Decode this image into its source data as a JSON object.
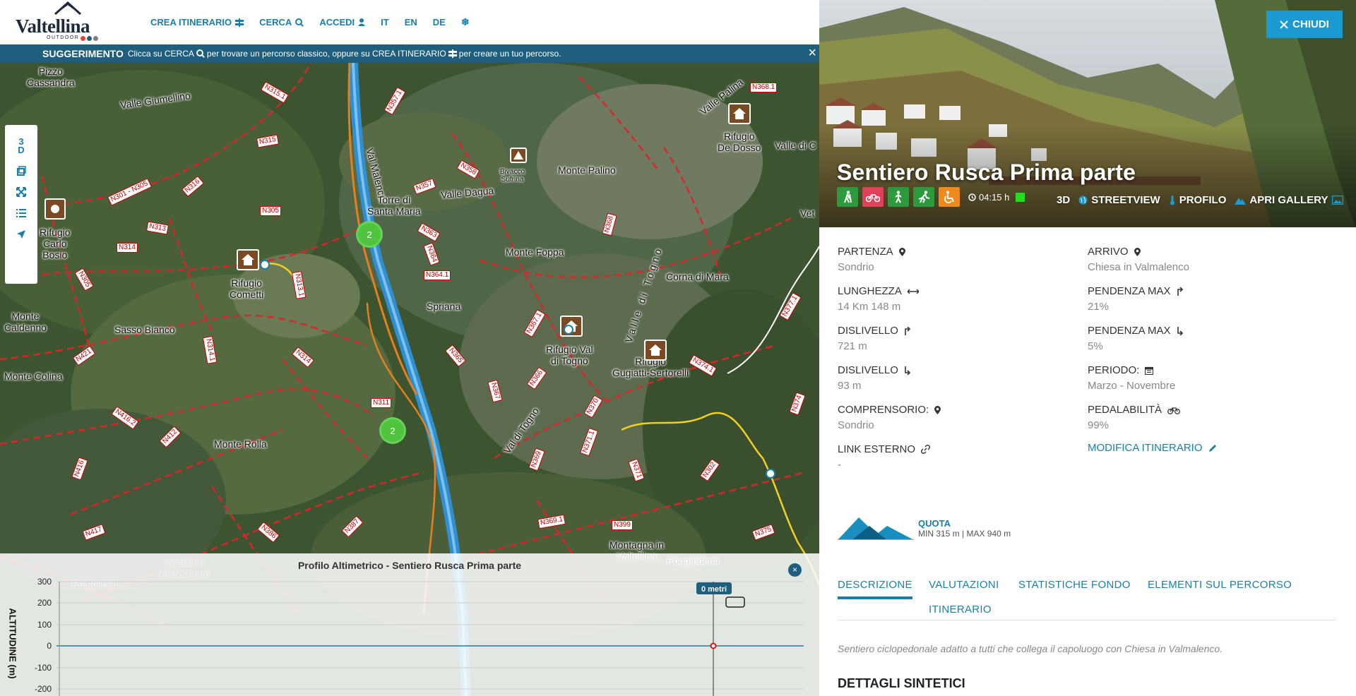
{
  "logo": {
    "brand": "Valtellina",
    "sub": "OUTDOOR",
    "dots": [
      "#e8403a",
      "#1f5f7d",
      "#7f7f7f"
    ]
  },
  "nav": {
    "crea": "CREA ITINERARIO",
    "cerca": "CERCA",
    "accedi": "ACCEDI",
    "lang_it": "IT",
    "lang_en": "EN",
    "lang_de": "DE"
  },
  "hint": {
    "title": "SUGGERIMENTO",
    "part1": "Clicca su CERCA",
    "part2": "per trovare un percorso classico, oppure su CREA ITINERARIO",
    "part3": "per creare un tuo percorso."
  },
  "map": {
    "controls": {
      "three_d": "3 D"
    },
    "labels": [
      {
        "id": "pizzo",
        "text": "Pizzo\nCassandra"
      },
      {
        "id": "giumellino",
        "text": "Valle Giumellino"
      },
      {
        "id": "malenco",
        "text": "Val Malenco"
      },
      {
        "id": "torre",
        "text": "Torre di\nSanta Maria"
      },
      {
        "id": "dagua",
        "text": "Valle Dagua"
      },
      {
        "id": "bivacco",
        "text": "Bivacco\nSufrina"
      },
      {
        "id": "palino",
        "text": "Monte Palino"
      },
      {
        "id": "vpalina",
        "text": "Valle Palina"
      },
      {
        "id": "dosso",
        "text": "Rifugio\nDe Dosso"
      },
      {
        "id": "valdi",
        "text": "Valle di C"
      },
      {
        "id": "vet",
        "text": "Vet"
      },
      {
        "id": "bosio",
        "text": "Rifugio\nCarlo\nBosio"
      },
      {
        "id": "cometti",
        "text": "Rifugio\nCometti"
      },
      {
        "id": "foppa",
        "text": "Monte Foppa"
      },
      {
        "id": "mara",
        "text": "Corna di Mara"
      },
      {
        "id": "spriana",
        "text": "Spriana"
      },
      {
        "id": "caldenno",
        "text": "Monte\nCaldenno"
      },
      {
        "id": "bianco",
        "text": "Sasso Bianco"
      },
      {
        "id": "togno_val",
        "text": "Valle di Togno"
      },
      {
        "id": "valtogno",
        "text": "Rifugio Val\ndi Togno"
      },
      {
        "id": "gugiatti",
        "text": "Rifugio\nGugiatti-Sertorelli"
      },
      {
        "id": "colina",
        "text": "Monte Colina"
      },
      {
        "id": "rolla",
        "text": "Monte Rolla"
      },
      {
        "id": "valdiTogno2",
        "text": "Val di Togno"
      },
      {
        "id": "montagna",
        "text": "Montagna in\nValtellina"
      },
      {
        "id": "poggiridenti",
        "text": "Poggiridenti"
      },
      {
        "id": "castione",
        "text": "Castione\nAndevenno"
      },
      {
        "id": "postalesio",
        "text": "Postalesio"
      }
    ],
    "trails": [
      "N315.1",
      "N357.1",
      "N315",
      "N301 - N305",
      "N316",
      "N358",
      "N357",
      "N305",
      "N313",
      "N314",
      "N363",
      "N364",
      "N368",
      "N368.1",
      "N313.1",
      "N364.1",
      "N305",
      "N367.1",
      "N377.1",
      "N421",
      "N416.2",
      "N412",
      "N416",
      "N417",
      "N386",
      "N387",
      "N314",
      "N311",
      "N365",
      "N366",
      "N368",
      "N370",
      "N371.1",
      "N369",
      "N371",
      "N369.1",
      "N399",
      "N302",
      "N375",
      "N374",
      "N374.1"
    ],
    "clusters": [
      "2",
      "2"
    ]
  },
  "profile": {
    "title": "Profilo Altimetrico - Sentiero Rusca  Prima parte",
    "ylabel": "ALTITUDINE (m)",
    "marker": "0 metri",
    "close": "×",
    "yticks": [
      "300",
      "200",
      "100",
      "0",
      "-100",
      "-200"
    ]
  },
  "route": {
    "close_label": "CHIUDI",
    "title": "Sentiero Rusca Prima parte",
    "duration": "04:15 h",
    "difficulty_color": "#22dd22",
    "activities": [
      {
        "name": "hiking-icon",
        "color": "#2e9a3e"
      },
      {
        "name": "mtb-icon",
        "color": "#e0405a"
      },
      {
        "name": "walking-icon",
        "color": "#2e9a3e"
      },
      {
        "name": "running-icon",
        "color": "#2e9a3e"
      },
      {
        "name": "wheelchair-icon",
        "color": "#f08a1c"
      }
    ],
    "links": {
      "three_d": "3D",
      "streetview": "STREETVIEW",
      "profilo": "PROFILO",
      "gallery": "APRI GALLERY"
    }
  },
  "details": {
    "partenza_label": "PARTENZA",
    "partenza": "Sondrio",
    "arrivo_label": "ARRIVO",
    "arrivo": "Chiesa in Valmalenco",
    "lunghezza_label": "LUNGHEZZA",
    "lunghezza": "14 Km 148 m",
    "pendenza_up_label": "PENDENZA MAX",
    "pendenza_up": "21%",
    "dislivello_up_label": "DISLIVELLO",
    "dislivello_up": "721 m",
    "pendenza_down_label": "PENDENZA MAX",
    "pendenza_down": "5%",
    "dislivello_down_label": "DISLIVELLO",
    "dislivello_down": "93 m",
    "periodo_label": "PERIODO:",
    "periodo": "Marzo - Novembre",
    "comprensorio_label": "COMPRENSORIO:",
    "comprensorio": "Sondrio",
    "pedalabilita_label": "PEDALABILITÀ",
    "pedalabilita": "99%",
    "link_label": "LINK ESTERNO",
    "link": "-",
    "modifica": "MODIFICA ITINERARIO"
  },
  "quota": {
    "label": "QUOTA",
    "value": "MIN 315 m | MAX 940 m"
  },
  "tabs": [
    "DESCRIZIONE",
    "VALUTAZIONI",
    "STATISTICHE FONDO",
    "ELEMENTI SUL PERCORSO",
    "ITINERARIO"
  ],
  "description": "Sentiero ciclopedonale adatto a tutti che collega il capoluogo con Chiesa in Valmalenco.",
  "section_title": "DETTAGLI SINTETICI"
}
